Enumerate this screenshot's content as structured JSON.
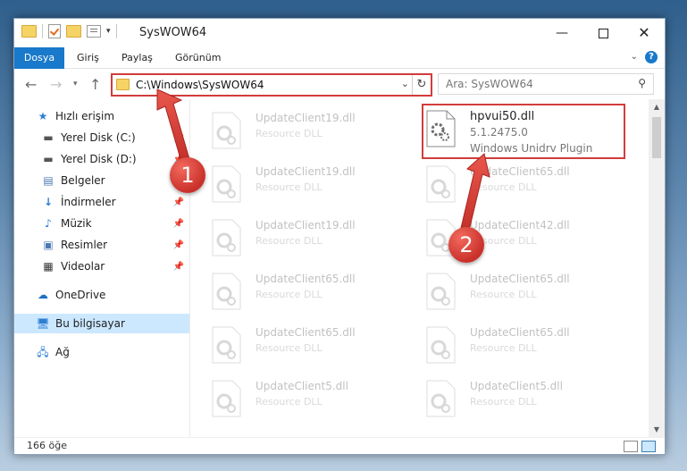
{
  "window": {
    "title": "SysWOW64",
    "minimize": "—",
    "close": "✕"
  },
  "ribbon": {
    "tabs": [
      "Dosya",
      "Giriş",
      "Paylaş",
      "Görünüm"
    ],
    "expand": "⌄",
    "help": "?"
  },
  "address": {
    "path": "C:\\Windows\\SysWOW64",
    "search_placeholder": "Ara: SysWOW64"
  },
  "nav": {
    "items": [
      {
        "label": "Hızlı erişim",
        "icon": "star-icon"
      },
      {
        "label": "Yerel Disk (C:)",
        "icon": "drive-icon",
        "pinned": true
      },
      {
        "label": "Yerel Disk (D:)",
        "icon": "drive-icon",
        "pinned": true
      },
      {
        "label": "Belgeler",
        "icon": "documents-icon",
        "pinned": true
      },
      {
        "label": "İndirmeler",
        "icon": "download-icon",
        "pinned": true
      },
      {
        "label": "Müzik",
        "icon": "music-icon",
        "pinned": true
      },
      {
        "label": "Resimler",
        "icon": "pictures-icon",
        "pinned": true
      },
      {
        "label": "Videolar",
        "icon": "videos-icon",
        "pinned": true
      },
      {
        "label": "OneDrive",
        "icon": "cloud-icon"
      },
      {
        "label": "Bu bilgisayar",
        "icon": "computer-icon",
        "selected": true
      },
      {
        "label": "Ağ",
        "icon": "network-icon"
      }
    ]
  },
  "files": {
    "highlighted": {
      "name": "hpvui50.dll",
      "version": "5.1.2475.0",
      "description": "Windows Unidrv Plugin"
    },
    "left": [
      {
        "name": "UpdateClient19.dll",
        "desc": "Resource DLL"
      },
      {
        "name": "UpdateClient19.dll",
        "desc": "Resource DLL"
      },
      {
        "name": "UpdateClient19.dll",
        "desc": "Resource DLL"
      },
      {
        "name": "UpdateClient65.dll",
        "desc": "Resource DLL"
      },
      {
        "name": "UpdateClient65.dll",
        "desc": "Resource DLL"
      },
      {
        "name": "UpdateClient5.dll",
        "desc": "Resource DLL"
      }
    ],
    "right": [
      {
        "name": "UpdateClient65.dll",
        "desc": "Resource DLL"
      },
      {
        "name": "UpdateClient42.dll",
        "desc": "Resource DLL"
      },
      {
        "name": "UpdateClient65.dll",
        "desc": "Resource DLL"
      },
      {
        "name": "UpdateClient65.dll",
        "desc": "Resource DLL"
      },
      {
        "name": "UpdateClient5.dll",
        "desc": "Resource DLL"
      }
    ]
  },
  "status": {
    "count": "166 öğe"
  },
  "annotations": {
    "step1": "1",
    "step2": "2"
  },
  "colors": {
    "accent": "#1979ca",
    "annotation": "#d23c3c",
    "selection": "#cce8ff"
  }
}
